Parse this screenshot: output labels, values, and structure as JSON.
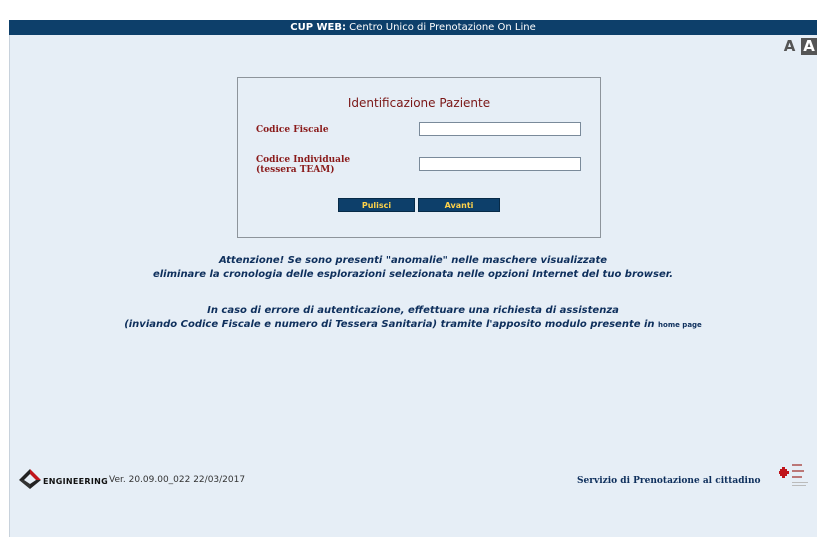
{
  "header": {
    "brand": "CUP WEB:",
    "title": " Centro Unico di Prenotazione On Line"
  },
  "font_controls": {
    "small": "A",
    "large": "A"
  },
  "form": {
    "title": "Identificazione Paziente",
    "codice_fiscale_label": "Codice Fiscale",
    "codice_fiscale_value": "",
    "codice_individuale_label_line1": "Codice Individuale",
    "codice_individuale_label_line2": "(tessera TEAM)",
    "codice_individuale_value": "",
    "pulisci_label": "Pulisci",
    "avanti_label": "Avanti"
  },
  "notices": {
    "line1": "Attenzione! Se sono presenti \"anomalie\" nelle maschere visualizzate",
    "line2": "eliminare la cronologia delle esplorazioni selezionata nelle opzioni Internet del tuo browser.",
    "line3": "In caso di errore di autenticazione, effettuare una richiesta di assistenza",
    "line4": "(inviando Codice Fiscale e numero di Tessera Sanitaria) tramite l'apposito modulo presente in ",
    "home_link": "home page"
  },
  "footer": {
    "logo_text": "ENGINEERING",
    "version": "Ver. 20.09.00_022 22/03/2017",
    "service": "Servizio di Prenotazione al cittadino"
  },
  "colors": {
    "header_bg": "#0d3f6a",
    "page_bg": "#e6eef6",
    "label_red": "#8a1a1a",
    "button_text": "#ffd24a",
    "notice_blue": "#0e2f5c"
  }
}
